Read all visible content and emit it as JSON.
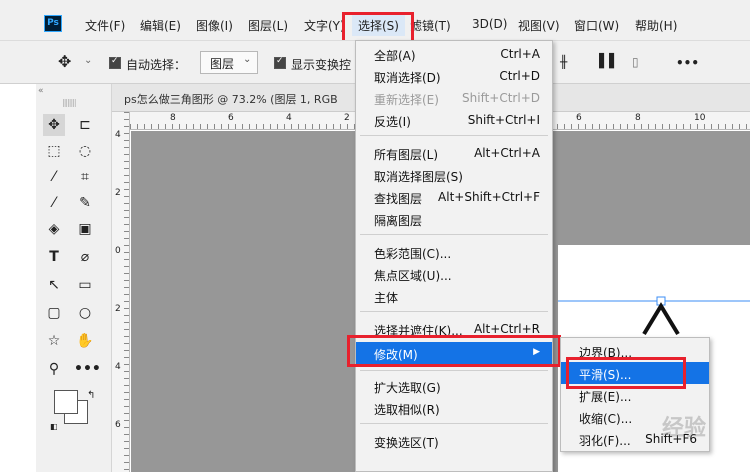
{
  "app": {
    "logo_text": "Ps",
    "menus": [
      "文件(F)",
      "编辑(E)",
      "图像(I)",
      "图层(L)",
      "文字(Y)",
      "选择(S)",
      "滤镜(T)",
      "3D(D)",
      "视图(V)",
      "窗口(W)",
      "帮助(H)"
    ]
  },
  "options_bar": {
    "auto_select_label": "自动选择：",
    "layer_select_value": "图层",
    "show_transform_label": "显示变换控",
    "more_label": "•••"
  },
  "document": {
    "tab_title": "ps怎么做三角图形 @ 73.2% (图层 1, RGB",
    "h_ruler_ticks": [
      "8",
      "6",
      "4",
      "2",
      "6",
      "8",
      "10"
    ],
    "v_ruler_ticks": [
      "4",
      "2",
      "0",
      "2",
      "4",
      "6"
    ]
  },
  "select_menu": {
    "items": [
      {
        "label": "全部(A)",
        "shortcut": "Ctrl+A",
        "disabled": false
      },
      {
        "label": "取消选择(D)",
        "shortcut": "Ctrl+D",
        "disabled": false
      },
      {
        "label": "重新选择(E)",
        "shortcut": "Shift+Ctrl+D",
        "disabled": true
      },
      {
        "label": "反选(I)",
        "shortcut": "Shift+Ctrl+I",
        "disabled": false
      },
      {
        "label": "所有图层(L)",
        "shortcut": "Alt+Ctrl+A",
        "disabled": false
      },
      {
        "label": "取消选择图层(S)",
        "shortcut": "",
        "disabled": false
      },
      {
        "label": "查找图层",
        "shortcut": "Alt+Shift+Ctrl+F",
        "disabled": false
      },
      {
        "label": "隔离图层",
        "shortcut": "",
        "disabled": false
      },
      {
        "label": "色彩范围(C)...",
        "shortcut": "",
        "disabled": false
      },
      {
        "label": "焦点区域(U)...",
        "shortcut": "",
        "disabled": false
      },
      {
        "label": "主体",
        "shortcut": "",
        "disabled": false
      },
      {
        "label": "选择并遮住(K)...",
        "shortcut": "Alt+Ctrl+R",
        "disabled": false
      },
      {
        "label": "修改(M)",
        "shortcut": "",
        "disabled": false
      },
      {
        "label": "扩大选取(G)",
        "shortcut": "",
        "disabled": false
      },
      {
        "label": "选取相似(R)",
        "shortcut": "",
        "disabled": false
      },
      {
        "label": "变换选区(T)",
        "shortcut": "",
        "disabled": false
      }
    ]
  },
  "modify_submenu": {
    "items": [
      {
        "label": "边界(B)...",
        "shortcut": ""
      },
      {
        "label": "平滑(S)...",
        "shortcut": ""
      },
      {
        "label": "扩展(E)...",
        "shortcut": ""
      },
      {
        "label": "收缩(C)...",
        "shortcut": ""
      },
      {
        "label": "羽化(F)...",
        "shortcut": "Shift+F6"
      }
    ]
  },
  "watermark": "经验",
  "colors": {
    "highlight": "#1473e6",
    "annotation_red": "#e8212d",
    "pasteboard": "#979797"
  }
}
